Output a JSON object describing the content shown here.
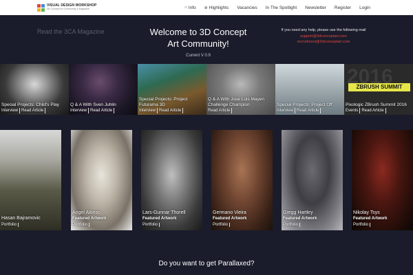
{
  "header": {
    "logo_title": "VISUAL DESIGN WORKSHOP",
    "logo_subtitle": "3D Concept Art Community & Magazine",
    "nav": [
      {
        "label": "Info",
        "icon": "home-icon"
      },
      {
        "label": "Highlights",
        "icon": "globe-icon"
      },
      {
        "label": "Vacancies",
        "icon": ""
      },
      {
        "label": "In The Spotlight",
        "icon": ""
      },
      {
        "label": "Newsletter",
        "icon": ""
      },
      {
        "label": "Register",
        "icon": ""
      },
      {
        "label": "Login",
        "icon": ""
      }
    ]
  },
  "hero": {
    "magazine_link": "Read the 3CA Magazine",
    "welcome_line1": "Welcome to 3D Concept",
    "welcome_line2": "Art Community!",
    "version": "Current V 0.9",
    "help_text": "If you need any help, please use the following mail",
    "support_email": "support@3dconceptart.com",
    "recruitment_email": "recruitment@3dconceptart.com"
  },
  "articles": [
    {
      "title": "Special Projects: Child's Play",
      "tags": [
        "Interview",
        "Read Article"
      ]
    },
    {
      "title": "Q & A With Sven Juhlin",
      "tags": [
        "Interview",
        "Read Article"
      ]
    },
    {
      "title": "Special Projects: Project Futurama 3D",
      "tags": [
        "Interview",
        "Read Article"
      ]
    },
    {
      "title": "Q & A With Jose Luis Mayen Challenge Champion",
      "tags": [
        "Read Article"
      ]
    },
    {
      "title": "Special Projects: Project Off",
      "tags": [
        "Interview",
        "Read Article"
      ]
    },
    {
      "title": "Pixologic ZBrush Summit 2016",
      "tags": [
        "Events",
        "Read Article"
      ],
      "banner": "ZBRUSH SUMMIT",
      "bg_text": "2016"
    }
  ],
  "artists": [
    {
      "name": "Hasan Bajramovic",
      "role": "",
      "link": "Portfolio"
    },
    {
      "name": "Angel Alonso",
      "role": "Featured Artwork",
      "link": "Portfolio"
    },
    {
      "name": "Lars-Gunnar Thorell",
      "role": "Featured Artwork",
      "link": "Portfolio"
    },
    {
      "name": "Germano Vieira",
      "role": "Featured Artwork",
      "link": "Portfolio"
    },
    {
      "name": "Gregg Hartley",
      "role": "Featured Artwork",
      "link": "Portfolio"
    },
    {
      "name": "Nikolay Tsys",
      "role": "Featured Artwork",
      "link": "Portfolio"
    }
  ],
  "footer": {
    "parallax_heading": "Do you want to get Parallaxed?"
  },
  "colors": {
    "page_bg": "#1a1c2b",
    "accent_red": "#e0473c",
    "zbrush_yellow": "#e6e64a"
  }
}
